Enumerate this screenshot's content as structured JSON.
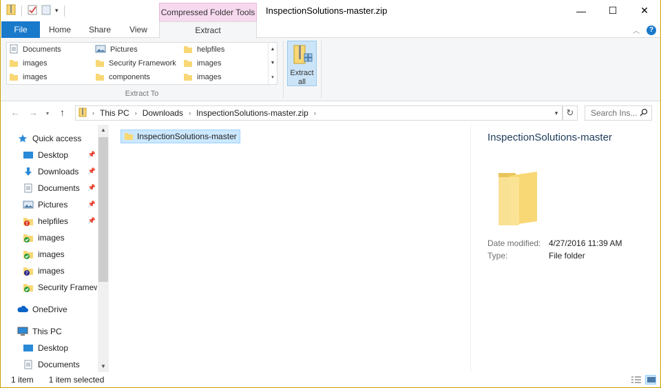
{
  "window": {
    "title": "InspectionSolutions-master.zip",
    "contextual_tab_group": "Compressed Folder Tools",
    "buttons": {
      "minimize": "—",
      "maximize": "☐",
      "close": "✕"
    }
  },
  "ribbon_tabs": [
    {
      "label": "File"
    },
    {
      "label": "Home"
    },
    {
      "label": "Share"
    },
    {
      "label": "View"
    },
    {
      "label": "Extract"
    }
  ],
  "ribbon": {
    "extract_to_items": [
      {
        "label": "Documents",
        "icon": "documents-icon"
      },
      {
        "label": "Pictures",
        "icon": "pictures-icon"
      },
      {
        "label": "helpfiles",
        "icon": "folder-icon"
      },
      {
        "label": "images",
        "icon": "folder-icon"
      },
      {
        "label": "Security Framework",
        "icon": "folder-icon"
      },
      {
        "label": "images",
        "icon": "folder-icon"
      },
      {
        "label": "images",
        "icon": "folder-icon"
      },
      {
        "label": "components",
        "icon": "folder-icon"
      },
      {
        "label": "images",
        "icon": "folder-icon"
      }
    ],
    "extract_to_group_label": "Extract To",
    "extract_all_line1": "Extract",
    "extract_all_line2": "all"
  },
  "address": {
    "crumbs": [
      "This PC",
      "Downloads",
      "InspectionSolutions-master.zip"
    ],
    "search_placeholder": "Search Ins..."
  },
  "nav": {
    "items": [
      {
        "label": "Quick access",
        "icon": "star-icon",
        "pinned": false
      },
      {
        "label": "Desktop",
        "icon": "desktop-icon",
        "pinned": true
      },
      {
        "label": "Downloads",
        "icon": "download-arrow-icon",
        "pinned": true
      },
      {
        "label": "Documents",
        "icon": "documents-icon",
        "pinned": true
      },
      {
        "label": "Pictures",
        "icon": "pictures-icon",
        "pinned": true
      },
      {
        "label": "helpfiles",
        "icon": "folder-error-icon",
        "pinned": true
      },
      {
        "label": "images",
        "icon": "folder-check-icon",
        "pinned": false
      },
      {
        "label": "images",
        "icon": "folder-check-icon",
        "pinned": false
      },
      {
        "label": "images",
        "icon": "folder-question-icon",
        "pinned": false
      },
      {
        "label": "Security Framew",
        "icon": "folder-check-icon",
        "pinned": false
      },
      {
        "label": "OneDrive",
        "icon": "cloud-icon",
        "pinned": false
      },
      {
        "label": "This PC",
        "icon": "computer-icon",
        "pinned": false
      },
      {
        "label": "Desktop",
        "icon": "desktop-icon",
        "pinned": false
      },
      {
        "label": "Documents",
        "icon": "documents-icon",
        "pinned": false
      }
    ]
  },
  "content": {
    "items": [
      {
        "label": "InspectionSolutions-master",
        "selected": true
      }
    ]
  },
  "details": {
    "title": "InspectionSolutions-master",
    "date_modified_label": "Date modified:",
    "date_modified_value": "4/27/2016 11:39 AM",
    "type_label": "Type:",
    "type_value": "File folder"
  },
  "status": {
    "item_count": "1 item",
    "selected_count": "1 item selected"
  },
  "colors": {
    "file_tab": "#1979ca",
    "contextual_tab": "#f7d9ef",
    "selection": "#cce8ff",
    "folder": "#f8d775"
  }
}
